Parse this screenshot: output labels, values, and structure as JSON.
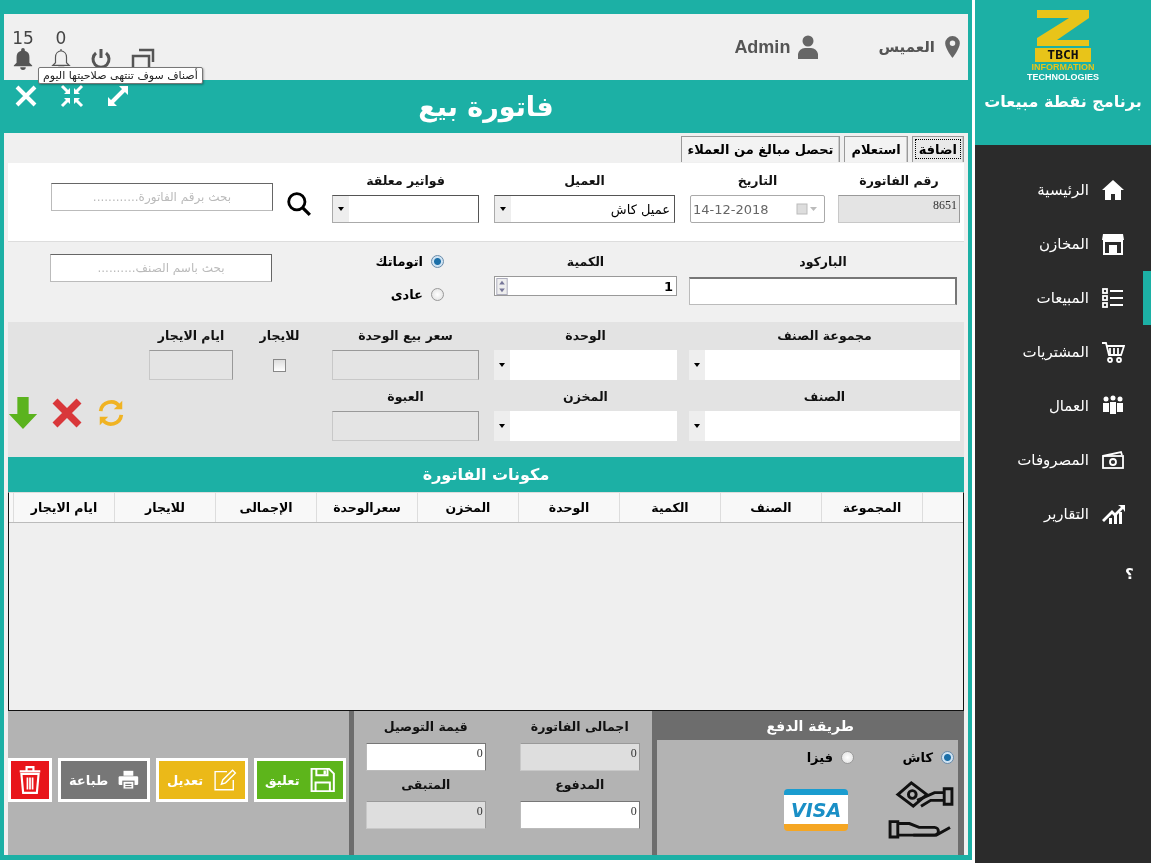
{
  "header": {
    "location": "العميس",
    "user": "Admin",
    "alerts": [
      {
        "count": "0"
      },
      {
        "count": "15"
      }
    ],
    "tooltip": "أصناف سوف تنتهى صلاحيتها اليوم"
  },
  "window": {
    "title": "فاتورة بيع"
  },
  "tabs": [
    {
      "label": "اضافة",
      "selected": true
    },
    {
      "label": "استعلام",
      "selected": false
    },
    {
      "label": "تحصل مبالغ من العملاء",
      "selected": false
    }
  ],
  "invoice_row": [
    {
      "kind": "text",
      "label": "رقم الفاتورة",
      "value": "8651",
      "disabled": true
    },
    {
      "kind": "date",
      "label": "التاريخ",
      "value": "14-12-2018",
      "disabled": true
    },
    {
      "kind": "combo",
      "label": "العميل",
      "value": "عميل كاش",
      "disabled": false
    },
    {
      "kind": "combo",
      "label": "فواتير معلقة",
      "disabled": false
    }
  ],
  "invoice_search": {
    "placeholder": "بحث برقم الفاتورة............"
  },
  "barcode": {
    "label": "الباركود"
  },
  "quantity": {
    "label": "الكمية",
    "value": "1"
  },
  "entry_modes": [
    {
      "label": "اتوماتك",
      "selected": true
    },
    {
      "label": "عادى",
      "selected": false
    }
  ],
  "item_search": {
    "placeholder": "بحث باسم الصنف.........."
  },
  "item_rows": [
    [
      {
        "kind": "combo",
        "label": "مجموعة الصنف",
        "disabled": false
      },
      {
        "kind": "combo",
        "label": "الوحدة",
        "disabled": false
      },
      {
        "kind": "text",
        "label": "سعر بيع  الوحدة",
        "disabled": true
      },
      {
        "kind": "check",
        "label": "للايجار",
        "checked": false
      },
      {
        "kind": "text",
        "label": "ايام الايجار",
        "disabled": true
      }
    ],
    [
      {
        "kind": "combo",
        "label": "الصنف",
        "disabled": false
      },
      {
        "kind": "combo",
        "label": "المخزن",
        "disabled": false
      },
      {
        "kind": "text",
        "label": "العبوة",
        "disabled": true
      }
    ]
  ],
  "table": {
    "title": "مكونات الفاتورة",
    "columns": [
      "المجموعة",
      "الصنف",
      "الكمية",
      "الوحدة",
      "المخزن",
      "سعرالوحدة",
      "الإجمالى",
      "للايجار",
      "ايام الايجار"
    ]
  },
  "totals": [
    {
      "label": "اجمالى الفاتورة",
      "value": "0",
      "disabled": true
    },
    {
      "label": "قيمة التوصيل",
      "value": "0",
      "disabled": false
    },
    {
      "label": "المدفوع",
      "value": "0",
      "disabled": false
    },
    {
      "label": "المتبقى",
      "value": "0",
      "disabled": true
    }
  ],
  "actions": [
    {
      "kind": "save",
      "label": "تعليق"
    },
    {
      "kind": "edit",
      "label": "تعديل"
    },
    {
      "kind": "print",
      "label": "طباعة"
    },
    {
      "kind": "delete"
    }
  ],
  "payment": {
    "title": "طريقة الدفع",
    "methods": [
      {
        "label": "كاش",
        "selected": true
      },
      {
        "label": "فيزا",
        "selected": false
      }
    ],
    "card_text": "VISA"
  },
  "sidebar": {
    "brand": "TBCH",
    "brand_lines": [
      "INFORMATION",
      "TECHNOLOGIES"
    ],
    "title": "برنامج نقطة مبيعات",
    "items": [
      {
        "label": "الرئيسية",
        "selected": false
      },
      {
        "label": "المخازن",
        "selected": false
      },
      {
        "label": "المبيعات",
        "selected": true
      },
      {
        "label": "المشتريات",
        "selected": false
      },
      {
        "label": "العمال",
        "selected": false
      },
      {
        "label": "المصروفات",
        "selected": false
      },
      {
        "label": "التقارير",
        "selected": false
      }
    ],
    "help": "؟"
  }
}
